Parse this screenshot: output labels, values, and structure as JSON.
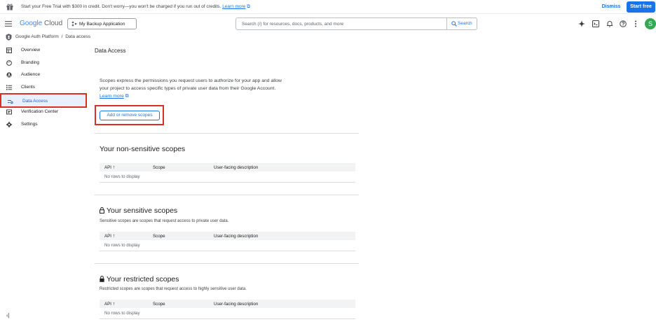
{
  "promo": {
    "text": "Start your Free Trial with $300 in credit. Don't worry—you won't be charged if you run out of credits.",
    "link": "Learn more",
    "dismiss": "Dismiss",
    "start": "Start free"
  },
  "header": {
    "logo_google": "Google",
    "logo_cloud": "Cloud",
    "project": "My Backup Application",
    "search_placeholder": "Search (/) for resources, docs, products, and more",
    "search_button": "Search",
    "avatar_initial": "S"
  },
  "breadcrumb": {
    "parent": "Google Auth Platform",
    "separator": "/",
    "current": "Data access"
  },
  "sidebar": {
    "items": [
      {
        "label": "Overview",
        "icon": "dashboard-icon"
      },
      {
        "label": "Branding",
        "icon": "palette-icon"
      },
      {
        "label": "Audience",
        "icon": "person-icon"
      },
      {
        "label": "Clients",
        "icon": "list-icon"
      },
      {
        "label": "Data Access",
        "icon": "tune-icon",
        "active": true
      },
      {
        "label": "Verification Center",
        "icon": "verified-icon"
      },
      {
        "label": "Settings",
        "icon": "gear-icon"
      }
    ]
  },
  "main": {
    "title": "Data Access",
    "intro": "Scopes express the permissions you request users to authorize for your app and allow your project to access specific types of private user data from their Google Account.",
    "intro_link": "Learn more",
    "add_button": "Add or remove scopes",
    "table_headers": {
      "api": "API",
      "scope": "Scope",
      "desc": "User-facing description"
    },
    "empty_text": "No rows to display",
    "sections": [
      {
        "title": "Your non-sensitive scopes",
        "subtitle": ""
      },
      {
        "title": "Your sensitive scopes",
        "subtitle": "Sensitive scopes are scopes that request access to private user data."
      },
      {
        "title": "Your restricted scopes",
        "subtitle": "Restricted scopes are scopes that request access to highly sensitive user data."
      }
    ]
  },
  "colors": {
    "accent": "#1a73e8",
    "highlight": "#d93025",
    "active_bg": "#e8f0fe"
  }
}
